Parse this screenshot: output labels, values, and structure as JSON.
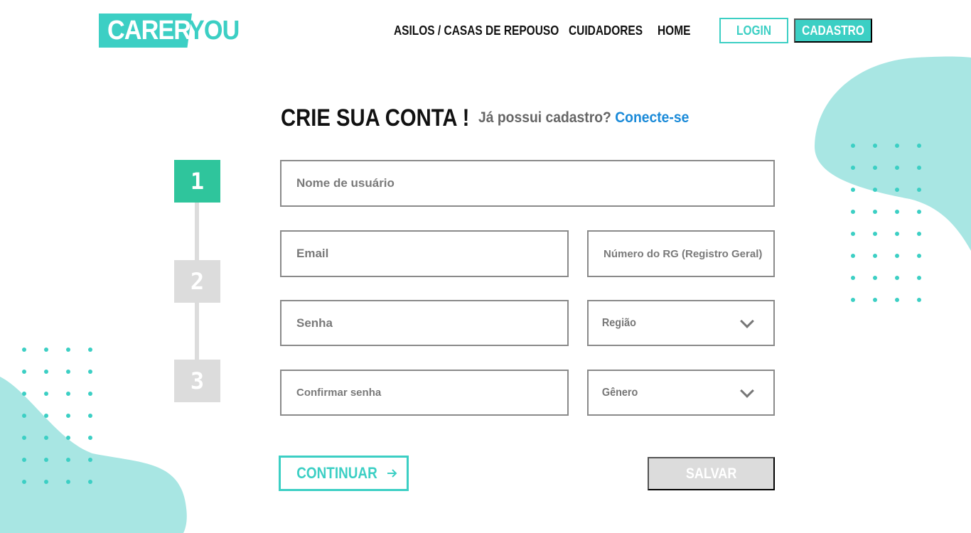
{
  "brand": {
    "part1": "CARER",
    "part2": "YOU",
    "accent_color": "#3ccfc4"
  },
  "nav": {
    "items": [
      {
        "label": "ASILOS / CASAS DE REPOUSO"
      },
      {
        "label": "CUIDADORES"
      },
      {
        "label": "HOME"
      }
    ],
    "login_label": "LOGIN",
    "signup_label": "CADASTRO"
  },
  "heading": {
    "title": "CRIE SUA CONTA !",
    "prompt": "Já possui cadastro?",
    "link": "Conecte-se"
  },
  "stepper": {
    "steps": [
      {
        "label": "1",
        "state": "active"
      },
      {
        "label": "2",
        "state": "inactive"
      },
      {
        "label": "3",
        "state": "inactive"
      }
    ],
    "active_color": "#2fc59c",
    "inactive_color": "#dcdcdc"
  },
  "form": {
    "username": {
      "placeholder": "Nome de usuário",
      "value": ""
    },
    "email": {
      "placeholder": "Email",
      "value": ""
    },
    "rg": {
      "placeholder": "Número do RG (Registro Geral)",
      "value": ""
    },
    "password": {
      "placeholder": "Senha",
      "value": ""
    },
    "region": {
      "selected": "Região"
    },
    "confirm_password": {
      "placeholder": "Confirmar senha",
      "value": ""
    },
    "gender": {
      "selected": "Gênero"
    }
  },
  "actions": {
    "continue_label": "CONTINUAR",
    "continue_icon": "arrow-right-icon",
    "save_label": "SALVAR"
  }
}
